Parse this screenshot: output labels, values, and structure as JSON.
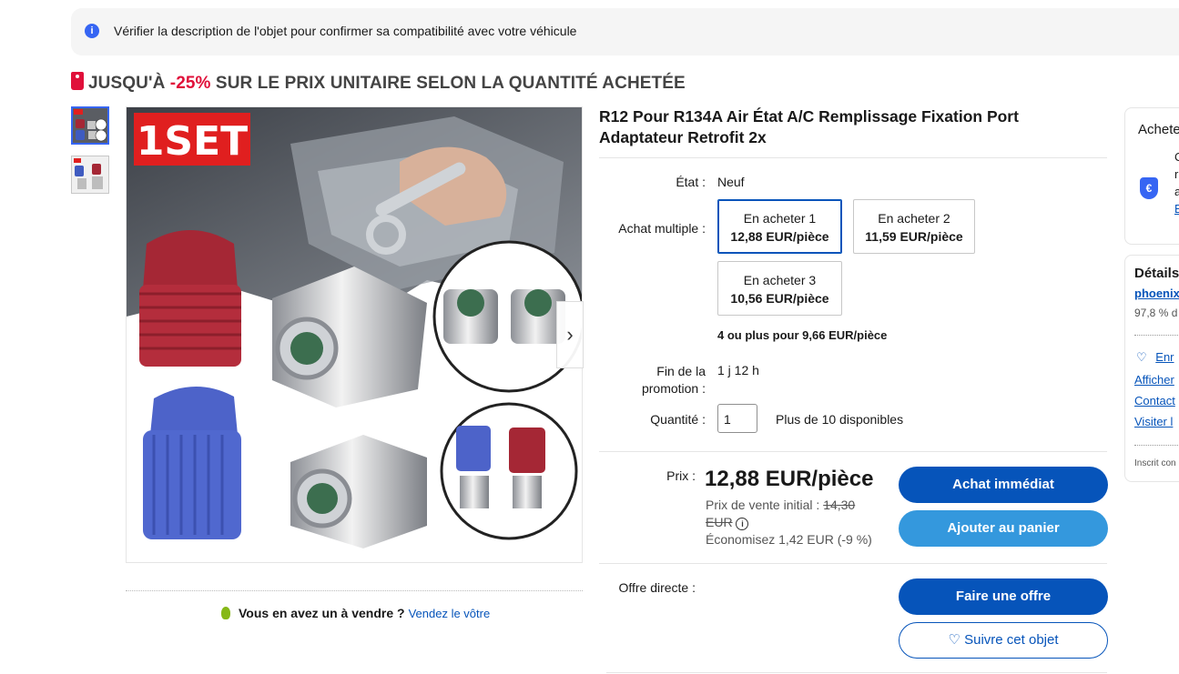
{
  "banner": {
    "text": "Vérifier la description de l'objet pour confirmer sa compatibilité avec votre véhicule"
  },
  "promo": {
    "prefix": "JUSQU'À ",
    "percent": "-25%",
    "suffix": " SUR LE PRIX UNITAIRE SELON LA QUANTITÉ ACHETÉE"
  },
  "image": {
    "badge": "1SET"
  },
  "title": "R12 Pour R134A Air État A/C Remplissage Fixation Port Adaptateur Retrofit 2x",
  "condition": {
    "label": "État :",
    "value": "Neuf"
  },
  "multi": {
    "label": "Achat multiple :",
    "options": [
      {
        "qty": "En acheter 1",
        "price": "12,88 EUR/pièce"
      },
      {
        "qty": "En acheter 2",
        "price": "11,59 EUR/pièce"
      },
      {
        "qty": "En acheter 3",
        "price": "10,56 EUR/pièce"
      }
    ],
    "more": "4 ou plus pour 9,66 EUR/pièce"
  },
  "promoend": {
    "label1": "Fin de la",
    "label2": "promotion :",
    "value": "1 j 12 h"
  },
  "quantity": {
    "label": "Quantité :",
    "value": "1",
    "available": "Plus de 10 disponibles"
  },
  "price": {
    "label": "Prix :",
    "value": "12,88 EUR/pièce",
    "initial_label": "Prix de vente initial :",
    "initial_value_1": "14,30",
    "initial_value_2": "EUR",
    "savings": "Économisez 1,42 EUR (-9 %)"
  },
  "buttons": {
    "buy_now": "Achat immédiat",
    "add_cart": "Ajouter au panier",
    "offer": "Faire une offre",
    "watch": "Suivre cet objet"
  },
  "offer": {
    "label": "Offre directe :"
  },
  "sell": {
    "question": "Vous en avez un à vendre ?",
    "link": "Vendez le vôtre"
  },
  "right_panel1": {
    "title": "Achete",
    "line1": "C",
    "line2": "r",
    "line3": "a",
    "link": "E"
  },
  "right_panel2": {
    "title": "Détails",
    "seller": "phoenix",
    "rating": "97,8 % d",
    "save": "Enr",
    "link1": "Afficher",
    "link2": "Contact",
    "link3": "Visiter l",
    "footer": "Inscrit con"
  },
  "colors": {
    "accent": "#0654ba",
    "secondary": "#3498dd",
    "promo": "#e0103a"
  }
}
